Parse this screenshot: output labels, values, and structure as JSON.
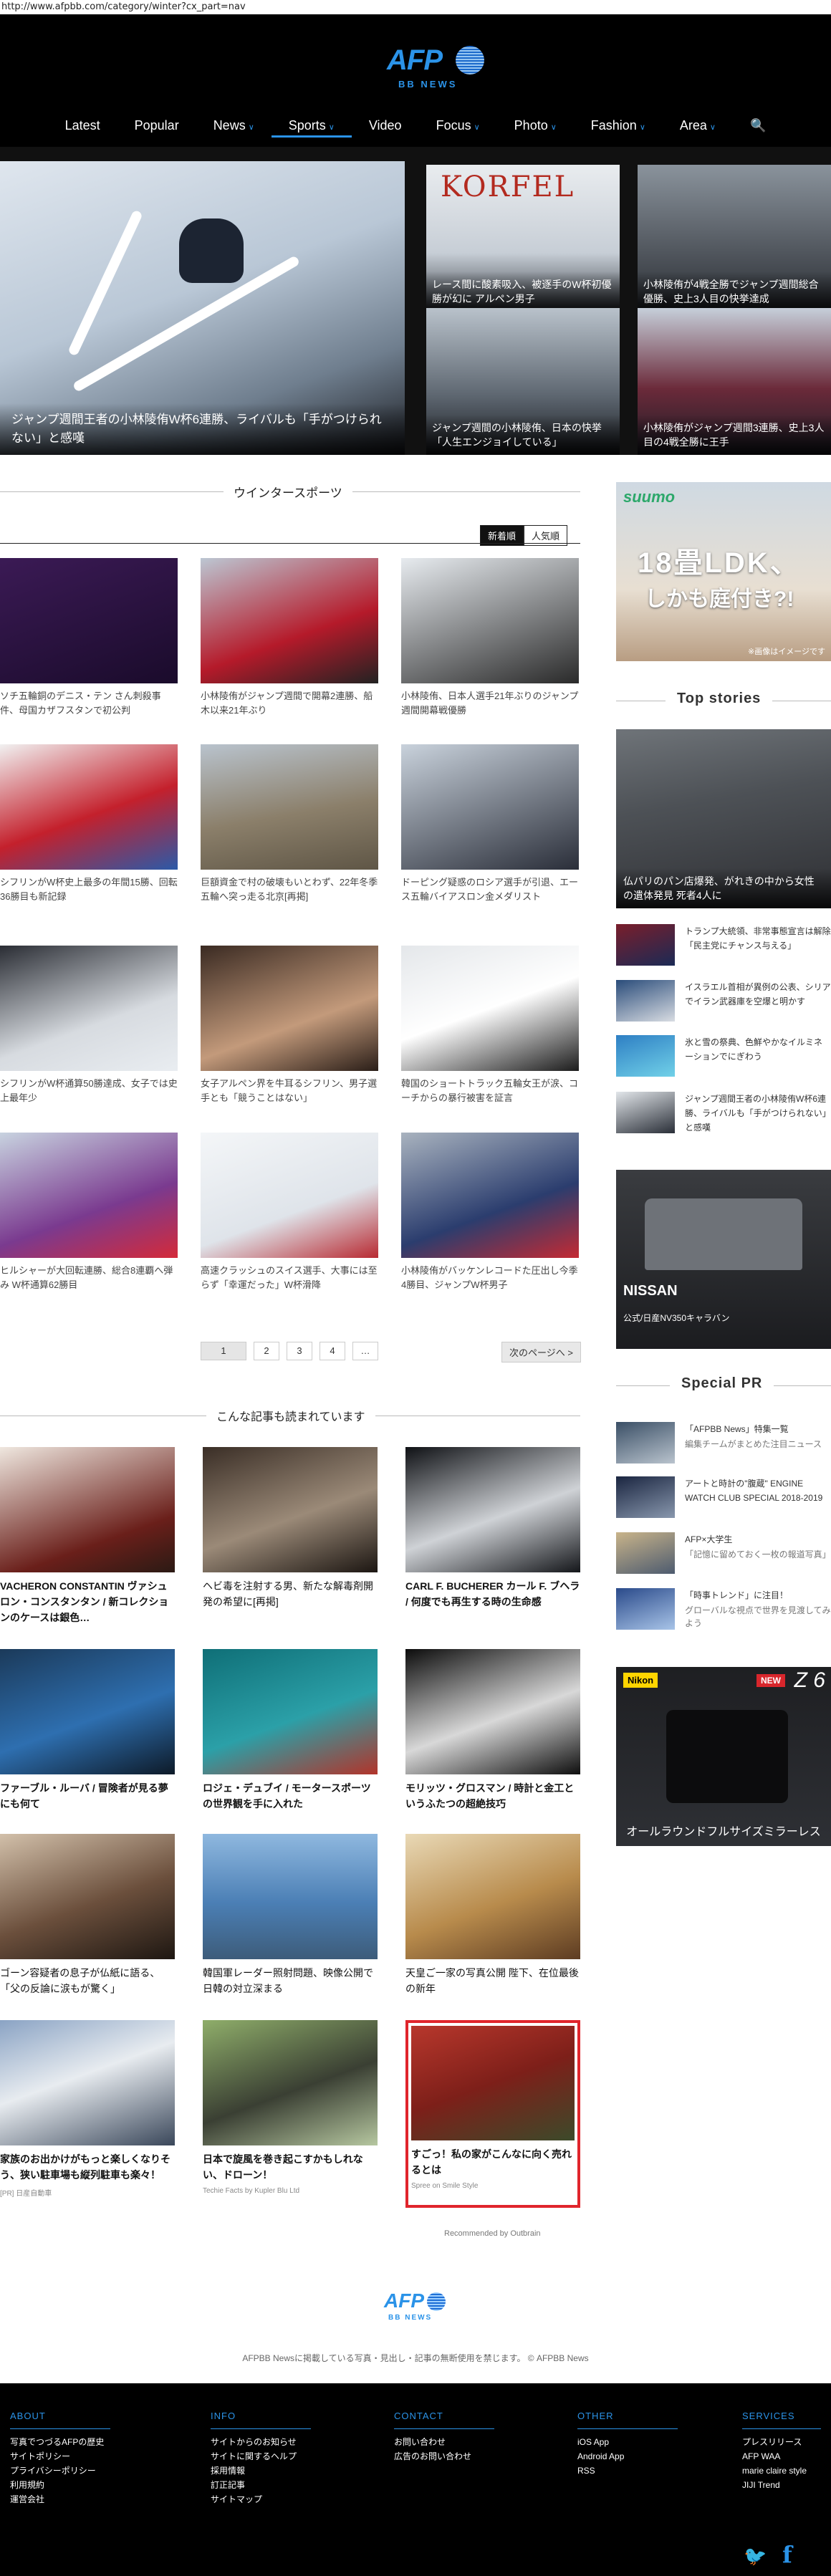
{
  "url": "http://www.afpbb.com/category/winter?cx_part=nav",
  "brand": {
    "logo_text": "AFP",
    "sub_text": "BB NEWS"
  },
  "nav": [
    {
      "label": "Latest",
      "chevron": false
    },
    {
      "label": "Popular",
      "chevron": false
    },
    {
      "label": "News",
      "chevron": true
    },
    {
      "label": "Sports",
      "chevron": true
    },
    {
      "label": "Video",
      "chevron": false
    },
    {
      "label": "Focus",
      "chevron": true
    },
    {
      "label": "Photo",
      "chevron": true
    },
    {
      "label": "Fashion",
      "chevron": true
    },
    {
      "label": "Area",
      "chevron": true
    }
  ],
  "hero": {
    "main_caption": "ジャンプ週間王者の小林陵侑W杯6連勝、ライバルも「手がつけられない」と感嘆",
    "tiles": [
      {
        "caption": "レース間に酸素吸入、被逐手のW杯初優勝が幻に アルペン男子",
        "banner": "KORFEL"
      },
      {
        "caption": "小林陵侑が4戦全勝でジャンプ週間総合優勝、史上3人目の快挙達成"
      },
      {
        "caption": "ジャンプ週間の小林陵侑、日本の快挙「人生エンジョイしている」"
      },
      {
        "caption": "小林陵侑がジャンプ週間3連勝、史上3人目の4戦全勝に王手"
      }
    ]
  },
  "section_title": "ウインタースポーツ",
  "tabs": [
    "新着順",
    "人気順"
  ],
  "articles": [
    "ソチ五輪銅のデニス・テン さん刺殺事件、母国カザフスタンで初公判",
    "小林陵侑がジャンプ週間で開幕2連勝、船木以来21年ぶり",
    "小林陵侑、日本人選手21年ぶりのジャンプ週間開幕戦優勝",
    "シフリンがW杯史上最多の年間15勝、回転36勝目も新記録",
    "巨額資金で村の破壊もいとわず、22年冬季五輪へ突っ走る北京[再掲]",
    "ドーピング疑惑のロシア選手が引退、エース五輪バイアスロン金メダリスト",
    "シフリンがW杯通算50勝達成、女子では史上最年少",
    "女子アルペン界を牛耳るシフリン、男子選手とも「競うことはない」",
    "韓国のショートトラック五輪女王が涙、コーチからの暴行被害を証言",
    "ヒルシャーが大回転連勝、総合8連覇へ弾み W杯通算62勝目",
    "高速クラッシュのスイス選手、大事には至らず「幸運だった」W杯滑降",
    "小林陵侑がバッケンレコードた圧出し今季4勝目、ジャンプW杯男子"
  ],
  "pager": {
    "pages": [
      "1",
      "2",
      "3",
      "4",
      "…"
    ],
    "next": "次のページへ >"
  },
  "recommended_title": "こんな記事も読まれています",
  "recommended": [
    {
      "text": "VACHERON CONSTANTIN ヴァシュロン・コンスタンタン / 新コレクションのケースは銀色…",
      "bold": true
    },
    {
      "text": "ヘビ毒を注射する男、新たな解毒剤開発の希望に[再掲]",
      "bold": false
    },
    {
      "text": "CARL F. BUCHERER カール F. ブヘラ / 何度でも再生する時の生命感",
      "bold": true
    },
    {
      "text": "ファーブル・ルーバ / 冒険者が見る夢にも何て",
      "bold": true
    },
    {
      "text": "ロジェ・デュブイ / モータースポーツの世界観を手に入れた",
      "bold": true
    },
    {
      "text": "モリッツ・グロスマン / 時計と金工というふたつの超絶技巧",
      "bold": true
    },
    {
      "text": "ゴーン容疑者の息子が仏紙に語る、「父の反論に涙もが驚く」",
      "bold": false
    },
    {
      "text": "韓国軍レーダー照射問題、映像公開で日韓の対立深まる",
      "bold": false
    },
    {
      "text": "天皇ご一家の写真公開 陛下、在位最後の新年",
      "bold": false
    },
    {
      "text": "家族のお出かけがもっと楽しくなりそう、狭い駐車場も縦列駐車も楽々！",
      "bold": true,
      "source": "[PR] 日産自動車"
    },
    {
      "text": "日本で旋風を巻き起こすかもしれない、ドローン！",
      "bold": true,
      "source": "Techie Facts by Kupler Blu Ltd"
    },
    {
      "text": "すごっ！私の家がこんなに向く売れるとは",
      "bold": true,
      "source": "Spree on Smile Style"
    }
  ],
  "recommended_by": "Recommended by Outbrain",
  "sidebar": {
    "ad1": {
      "brand": "suumo",
      "headline": "18畳LDK、",
      "sub": "しかも庭付き?!",
      "note": "※画像はイメージです"
    },
    "top_stories_title": "Top stories",
    "top_story_main": "仏パリのパン店爆発、がれきの中から女性の遺体発見 死者4人に",
    "top_stories": [
      "トランプ大統領、非常事態宣言は解除「民主党にチャンス与える」",
      "イスラエル首相が異例の公表、シリアでイラン武器庫を空爆と明かす",
      "氷と雪の祭典、色鮮やかなイルミネーションでにぎわう",
      "ジャンプ週間王者の小林陵侑W杯6連勝、ライバルも「手がつけられない」と感嘆"
    ],
    "ad2": {
      "brand": "NISSAN",
      "sub": "公式/日産NV350キャラバン"
    },
    "special_pr_title": "Special PR",
    "special_pr": [
      {
        "title": "「AFPBB News」特集一覧",
        "sub": "編集チームがまとめた注目ニュース"
      },
      {
        "title": "アートと時計の\"腹蔵\" ENGINE WATCH CLUB SPECIAL 2018-2019",
        "sub": ""
      },
      {
        "title": "AFP×大学生",
        "sub": "「記憶に留めておく一枚の報道写真」"
      },
      {
        "title": "「時事トレンド」に注目！",
        "sub": "グローバルな視点で世界を見渡してみよう"
      }
    ],
    "ad3": {
      "brand": "Nikon",
      "badge": "NEW",
      "model": "Z 6",
      "caption": "オールラウンドフルサイズミラーレス"
    }
  },
  "bottom": {
    "copyright": "AFPBB Newsに掲載している写真・見出し・記事の無断使用を禁じます。 © AFPBB News"
  },
  "footer": [
    {
      "title": "ABOUT",
      "links": [
        "写真でつづるAFPの歴史",
        "サイトポリシー",
        "プライバシーポリシー",
        "利用規約",
        "運営会社"
      ]
    },
    {
      "title": "INFO",
      "links": [
        "サイトからのお知らせ",
        "サイトに関するヘルプ",
        "採用情報",
        "訂正記事",
        "サイトマップ"
      ]
    },
    {
      "title": "CONTACT",
      "links": [
        "お問い合わせ",
        "広告のお問い合わせ"
      ]
    },
    {
      "title": "OTHER",
      "links": [
        "iOS App",
        "Android App",
        "RSS"
      ]
    },
    {
      "title": "SERVICES",
      "links": [
        "プレスリリース",
        "AFP WAA",
        "marie claire style",
        "JIJI Trend"
      ]
    }
  ],
  "colors": {
    "accent": "#2b93e8",
    "header_bg": "#000000",
    "highlight_border": "#e0252c"
  }
}
